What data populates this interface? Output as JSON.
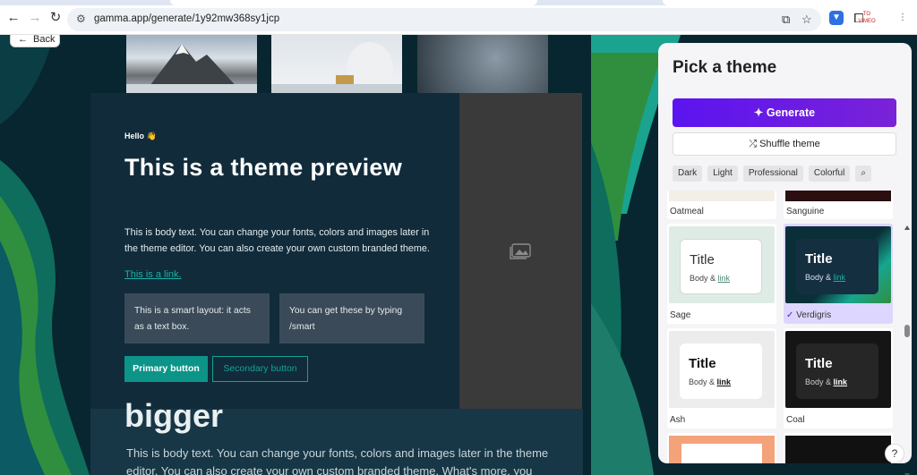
{
  "browser": {
    "url": "gamma.app/generate/1y92mw368sy1jcp",
    "ext_label": "TO VIMEO"
  },
  "page": {
    "back_label": "Back",
    "hello": "Hello 👋",
    "title": "This is a theme preview",
    "body": "This is body text. You can change your fonts, colors and images later in the theme editor. You can also create your own custom branded theme.",
    "link": "This is a link.",
    "box1": "This is a smart layout: it acts as a text box.",
    "box2": "You can get these by typing /smart",
    "primary_button": "Primary button",
    "secondary_button": "Secondary button",
    "bigger": "bigger",
    "lower_body": "This is body text. You can change your fonts, colors and images later in the theme",
    "lower_body2": "editor. You can also create your own custom branded theme. What's more, you"
  },
  "panel": {
    "title": "Pick a theme",
    "generate": "Generate",
    "shuffle": "Shuffle theme",
    "chips": [
      "Dark",
      "Light",
      "Professional",
      "Colorful"
    ],
    "themes": [
      {
        "name": "Oatmeal"
      },
      {
        "name": "Sanguine"
      },
      {
        "name": "Sage",
        "title": "Title",
        "body": "Body & ",
        "link": "link"
      },
      {
        "name": "Verdigris",
        "title": "Title",
        "body": "Body & ",
        "link": "link",
        "selected": true
      },
      {
        "name": "Ash",
        "title": "Title",
        "body": "Body & ",
        "link": "link"
      },
      {
        "name": "Coal",
        "title": "Title",
        "body": "Body & ",
        "link": "link"
      }
    ],
    "help": "?"
  },
  "colors": {
    "accent": "#0d9488",
    "generate": "#5b14f0",
    "selected": "#ddd6fe"
  }
}
